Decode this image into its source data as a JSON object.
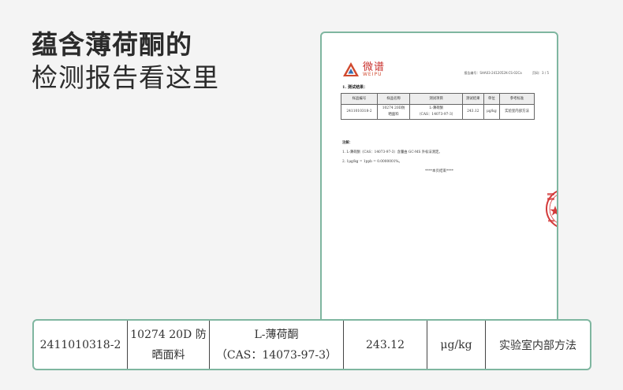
{
  "headline": {
    "line1": "蕴含薄荷酮的",
    "line2": "检测报告看这里"
  },
  "report": {
    "logo": {
      "cn": "微谱",
      "en": "WEIPU",
      "icon": "weipu-logo-icon",
      "color": "#c9302c"
    },
    "report_no": "报告编号：SHA03-2412052K-CS-02Ca",
    "page": "页码：3 / 5",
    "section_title": "1.  测试结果：",
    "table": {
      "headers": [
        "样品编号",
        "样品名称",
        "测试项目",
        "测试结果",
        "单位",
        "参考标准"
      ],
      "row": {
        "sample_no": "2411010318-2",
        "sample_name_1": "10274 20D防",
        "sample_name_2": "晒面料",
        "item_1": "L-薄荷酮",
        "item_2": "（CAS：14073-97-3）",
        "result": "243.12",
        "unit": "μg/kg",
        "standard": "实验室内部方法"
      }
    },
    "notes_title": "注解：",
    "note1": "1.      L-薄荷酮（CAS：14073-97-3）含量由 GC-MS 外标法测定。",
    "note2": "2.      1μg/kg = 1ppb = 0.0000001%。",
    "end_mark": "****本页结束****"
  },
  "zoom": {
    "sample_no": "2411010318-2",
    "sample_name_1": "10274 20D 防",
    "sample_name_2": "晒面料",
    "item_1": "L-薄荷酮",
    "item_2": "（CAS：14073-97-3）",
    "result": "243.12",
    "unit": "μg/kg",
    "standard": "实验室内部方法"
  },
  "colors": {
    "frame": "#7fb6a0",
    "background": "#f4f4f4",
    "stamp": "#d33a3a"
  }
}
